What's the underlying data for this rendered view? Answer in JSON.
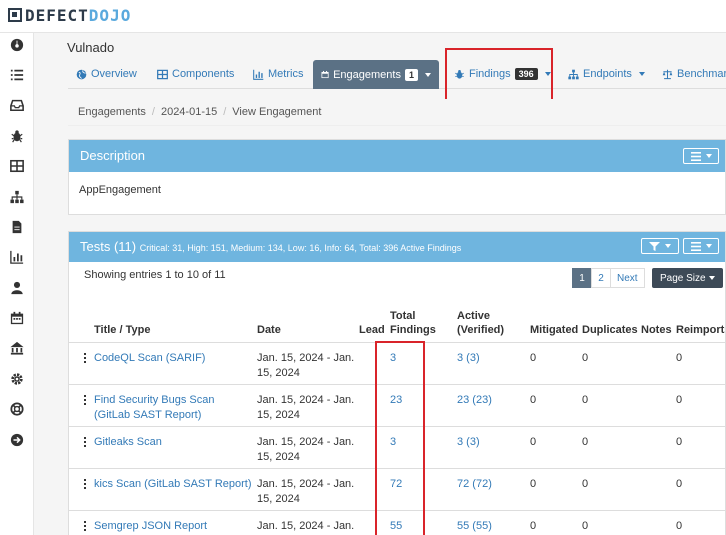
{
  "logo": {
    "part1": "DEFECT",
    "part2": "DOJO"
  },
  "sidebar_icons": [
    "dashboard-icon",
    "list-icon",
    "inbox-icon",
    "bug-icon",
    "grid-icon",
    "sitemap-icon",
    "file-icon",
    "chart-icon",
    "user-icon",
    "calendar-icon",
    "bank-icon",
    "gear-icon",
    "lifebuoy-icon",
    "arrow-circle-right-icon"
  ],
  "product": {
    "title": "Vulnado"
  },
  "tabs": {
    "overview": "Overview",
    "components": "Components",
    "metrics": "Metrics",
    "engagements": "Engagements",
    "engagements_count": "1",
    "findings": "Findings",
    "findings_count": "396",
    "endpoints": "Endpoints",
    "benchmark": "Benchmark"
  },
  "breadcrumb": {
    "item1": "Engagements",
    "item2": "2024-01-15",
    "item3": "View Engagement"
  },
  "description": {
    "title": "Description",
    "body": "AppEngagement"
  },
  "tests": {
    "title": "Tests (11)",
    "summary": "Critical: 31, High: 151, Medium: 134, Low: 16, Info: 64, Total: 396 Active Findings",
    "entries_text": "Showing entries 1 to 10 of 11",
    "pages": [
      "1",
      "2"
    ],
    "next_label": "Next",
    "page_size_label": "Page Size",
    "columns": {
      "title": "Title / Type",
      "date": "Date",
      "lead": "Lead",
      "total_1": "Total",
      "total_2": "Findings",
      "active_1": "Active",
      "active_2": "(Verified)",
      "mitigated": "Mitigated",
      "duplicates": "Duplicates",
      "notes": "Notes",
      "reimports": "Reimports"
    },
    "rows": [
      {
        "title": "CodeQL Scan (SARIF)",
        "date": "Jan. 15, 2024 - Jan. 15, 2024",
        "total": "3",
        "active": "3 (3)",
        "mitigated": "0",
        "duplicates": "0",
        "reimports": "0"
      },
      {
        "title": "Find Security Bugs Scan (GitLab SAST Report)",
        "date": "Jan. 15, 2024 - Jan. 15, 2024",
        "total": "23",
        "active": "23 (23)",
        "mitigated": "0",
        "duplicates": "0",
        "reimports": "0"
      },
      {
        "title": "Gitleaks Scan",
        "date": "Jan. 15, 2024 - Jan. 15, 2024",
        "total": "3",
        "active": "3 (3)",
        "mitigated": "0",
        "duplicates": "0",
        "reimports": "0"
      },
      {
        "title": "kics Scan (GitLab SAST Report)",
        "date": "Jan. 15, 2024 - Jan. 15, 2024",
        "total": "72",
        "active": "72 (72)",
        "mitigated": "0",
        "duplicates": "0",
        "reimports": "0"
      },
      {
        "title": "Semgrep JSON Report",
        "date": "Jan. 15, 2024 - Jan.",
        "total": "55",
        "active": "55 (55)",
        "mitigated": "0",
        "duplicates": "0",
        "reimports": "0"
      }
    ]
  },
  "colors": {
    "accent": "#6fb5df",
    "active_tab": "#5b7185",
    "highlight": "#d9242a",
    "link": "#337ab7"
  }
}
